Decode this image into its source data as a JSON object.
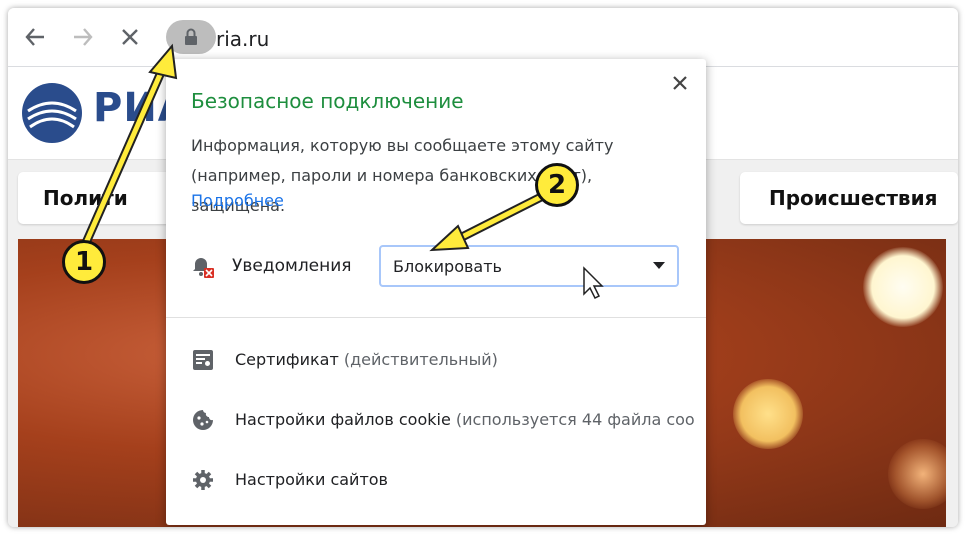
{
  "browser": {
    "url": "ria.ru",
    "back_icon": "arrow-left-icon",
    "forward_icon": "arrow-right-icon",
    "stop_icon": "close-icon",
    "lock_icon": "lock-icon"
  },
  "site": {
    "logo_text": "РИА",
    "nav": [
      "Полити",
      "Происшествия"
    ]
  },
  "popup": {
    "title": "Безопасное подключение",
    "description": "Информация, которую вы сообщаете этому сайту (например, пароли и номера банковских карт), защищена.",
    "more_link": "Подробнее",
    "notifications_label": "Уведомления",
    "notifications_value": "Блокировать",
    "rows": [
      {
        "label": "Сертификат",
        "sub": "(действительный)",
        "icon": "certificate-icon"
      },
      {
        "label": "Настройки файлов cookie",
        "sub": "(используется 44 файла соо",
        "icon": "cookie-icon"
      },
      {
        "label": "Настройки сайтов",
        "sub": "",
        "icon": "gear-icon"
      }
    ]
  },
  "annotations": {
    "badge1": "1",
    "badge2": "2"
  },
  "colors": {
    "secure_green": "#1e8e3e",
    "link_blue": "#1a73e8",
    "highlight_yellow": "#ffeb3b",
    "logo_blue": "#2a4c8c"
  }
}
